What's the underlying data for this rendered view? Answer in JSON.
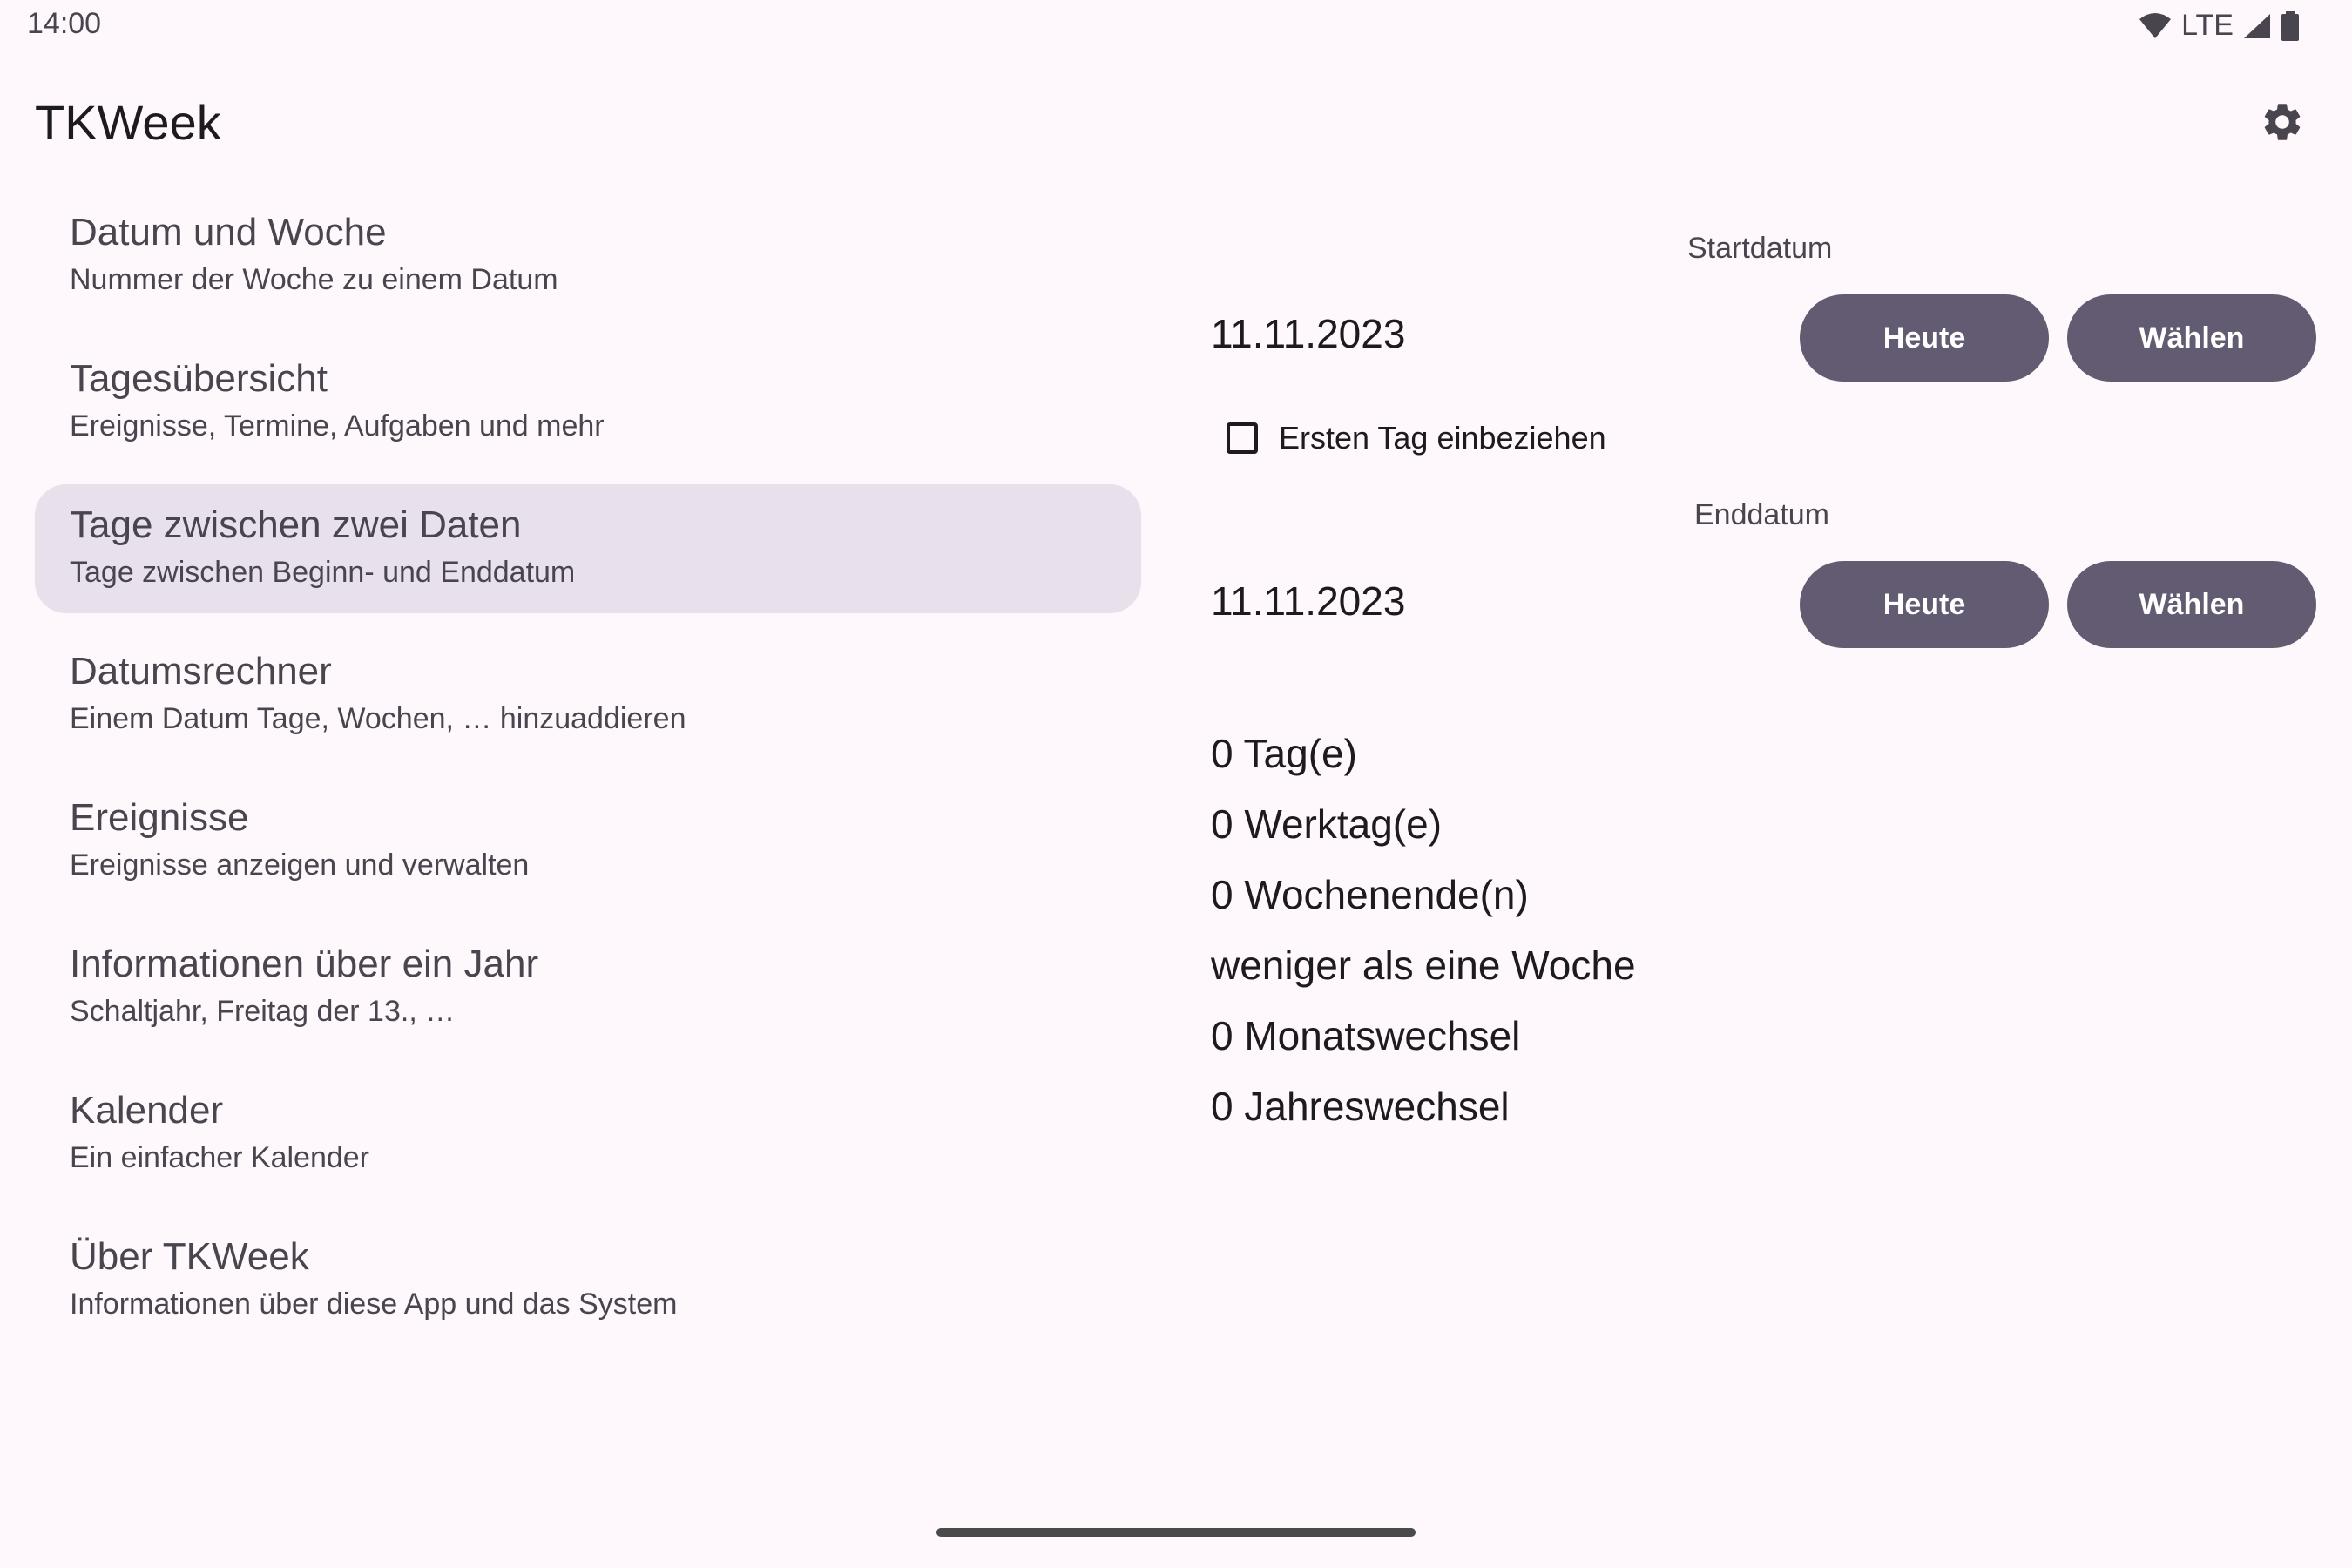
{
  "status_bar": {
    "time": "14:00",
    "network": "LTE",
    "icons": [
      "wifi-icon",
      "signal-icon",
      "battery-icon"
    ]
  },
  "app_bar": {
    "title": "TKWeek",
    "settings_icon": "gear-icon"
  },
  "nav": {
    "selected_index": 2,
    "items": [
      {
        "title": "Datum und Woche",
        "subtitle": "Nummer der Woche zu einem Datum"
      },
      {
        "title": "Tagesübersicht",
        "subtitle": "Ereignisse, Termine, Aufgaben und mehr"
      },
      {
        "title": "Tage zwischen zwei Daten",
        "subtitle": "Tage zwischen Beginn- und Enddatum"
      },
      {
        "title": "Datumsrechner",
        "subtitle": "Einem Datum Tage, Wochen, … hinzuaddieren"
      },
      {
        "title": "Ereignisse",
        "subtitle": "Ereignisse anzeigen und verwalten"
      },
      {
        "title": "Informationen über ein Jahr",
        "subtitle": "Schaltjahr, Freitag der 13., …"
      },
      {
        "title": "Kalender",
        "subtitle": "Ein einfacher Kalender"
      },
      {
        "title": "Über TKWeek",
        "subtitle": "Informationen über diese App und das System"
      }
    ]
  },
  "detail": {
    "start": {
      "label": "Startdatum",
      "date": "11.11.2023",
      "today_button": "Heute",
      "choose_button": "Wählen"
    },
    "include_first_day": {
      "label": "Ersten Tag einbeziehen",
      "checked": false
    },
    "end": {
      "label": "Enddatum",
      "date": "11.11.2023",
      "today_button": "Heute",
      "choose_button": "Wählen"
    },
    "results": [
      "0 Tag(e)",
      "0 Werktag(e)",
      "0 Wochenende(n)",
      "weniger als eine Woche",
      "0 Monatswechsel",
      "0 Jahreswechsel"
    ]
  },
  "colors": {
    "background": "#FEF7FB",
    "selected_item": "#E8E0EA",
    "button": "#625B71",
    "button_text": "#FFFFFF"
  }
}
